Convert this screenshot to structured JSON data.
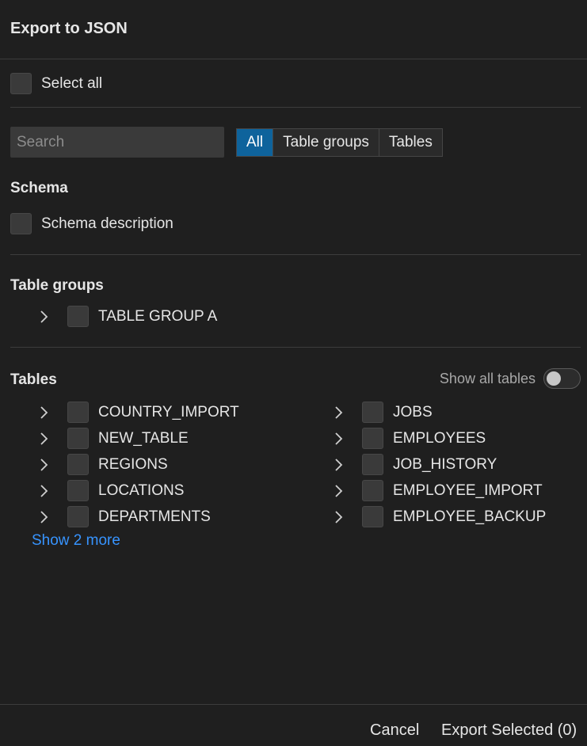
{
  "dialog": {
    "title": "Export to JSON"
  },
  "select_all": {
    "label": "Select all"
  },
  "filter": {
    "search_placeholder": "Search",
    "tabs": [
      {
        "label": "All",
        "active": true
      },
      {
        "label": "Table groups",
        "active": false
      },
      {
        "label": "Tables",
        "active": false
      }
    ]
  },
  "schema": {
    "heading": "Schema",
    "items": [
      {
        "label": "Schema description"
      }
    ]
  },
  "table_groups": {
    "heading": "Table groups",
    "items": [
      {
        "label": "TABLE GROUP A"
      }
    ]
  },
  "tables": {
    "heading": "Tables",
    "toggle_label": "Show all tables",
    "toggle_on": false,
    "left_column": [
      "COUNTRY_IMPORT",
      "NEW_TABLE",
      "REGIONS",
      "LOCATIONS",
      "DEPARTMENTS"
    ],
    "right_column": [
      "JOBS",
      "EMPLOYEES",
      "JOB_HISTORY",
      "EMPLOYEE_IMPORT",
      "EMPLOYEE_BACKUP"
    ],
    "show_more": "Show 2 more"
  },
  "footer": {
    "cancel": "Cancel",
    "export": "Export Selected (0)"
  },
  "colors": {
    "background": "#1f1f1f",
    "accent": "#0e639c",
    "link": "#3794ff"
  },
  "icons": {
    "expand": "chevron-right-icon"
  }
}
